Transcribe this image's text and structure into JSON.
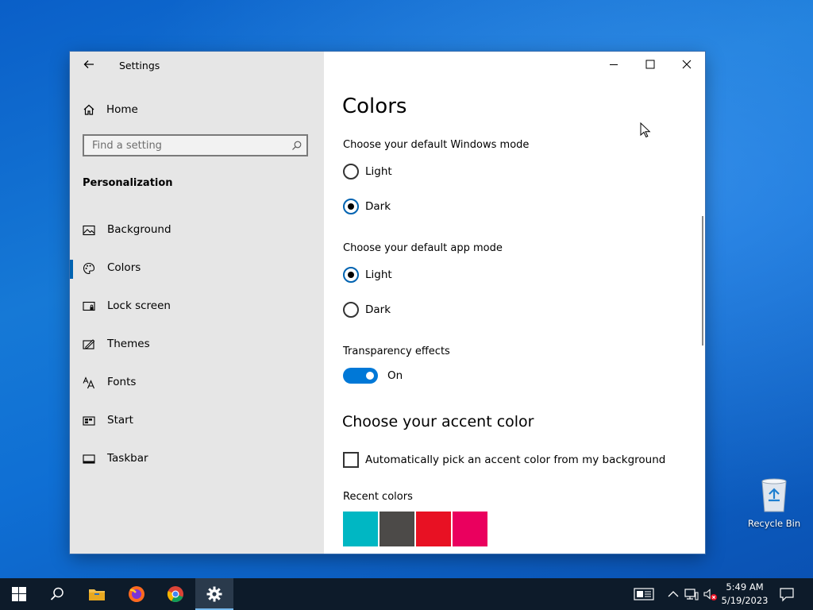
{
  "window": {
    "title": "Settings",
    "controls": [
      "minimize-icon",
      "maximize-icon",
      "close-icon"
    ]
  },
  "sidebar": {
    "home_label": "Home",
    "search_placeholder": "Find a setting",
    "section_heading": "Personalization",
    "items": [
      {
        "label": "Background",
        "icon": "picture-icon",
        "active": false
      },
      {
        "label": "Colors",
        "icon": "palette-icon",
        "active": true
      },
      {
        "label": "Lock screen",
        "icon": "lock-screen-icon",
        "active": false
      },
      {
        "label": "Themes",
        "icon": "themes-icon",
        "active": false
      },
      {
        "label": "Fonts",
        "icon": "fonts-icon",
        "active": false
      },
      {
        "label": "Start",
        "icon": "start-icon",
        "active": false
      },
      {
        "label": "Taskbar",
        "icon": "taskbar-icon",
        "active": false
      }
    ]
  },
  "main": {
    "title": "Colors",
    "windows_mode": {
      "label": "Choose your default Windows mode",
      "options": [
        "Light",
        "Dark"
      ],
      "selected": "Dark"
    },
    "app_mode": {
      "label": "Choose your default app mode",
      "options": [
        "Light",
        "Dark"
      ],
      "selected": "Light"
    },
    "transparency": {
      "label": "Transparency effects",
      "state": "On"
    },
    "accent": {
      "heading": "Choose your accent color",
      "auto_pick_label": "Automatically pick an accent color from my background",
      "auto_pick_checked": false,
      "recent_label": "Recent colors",
      "recent_colors": [
        "#00b7c3",
        "#4c4a48",
        "#e81123",
        "#ea005e"
      ]
    }
  },
  "desktop": {
    "recycle_bin_label": "Recycle Bin"
  },
  "taskbar": {
    "apps": [
      "start-icon",
      "search-icon",
      "file-explorer-icon",
      "firefox-icon",
      "chrome-icon",
      "settings-icon"
    ],
    "active_app": "settings-icon",
    "clock_time": "5:49 AM",
    "clock_date": "5/19/2023"
  },
  "colors": {
    "accent": "#0078d7",
    "sidebar_bg": "#e6e6e6",
    "taskbar_bg": "#0d1b2a"
  }
}
